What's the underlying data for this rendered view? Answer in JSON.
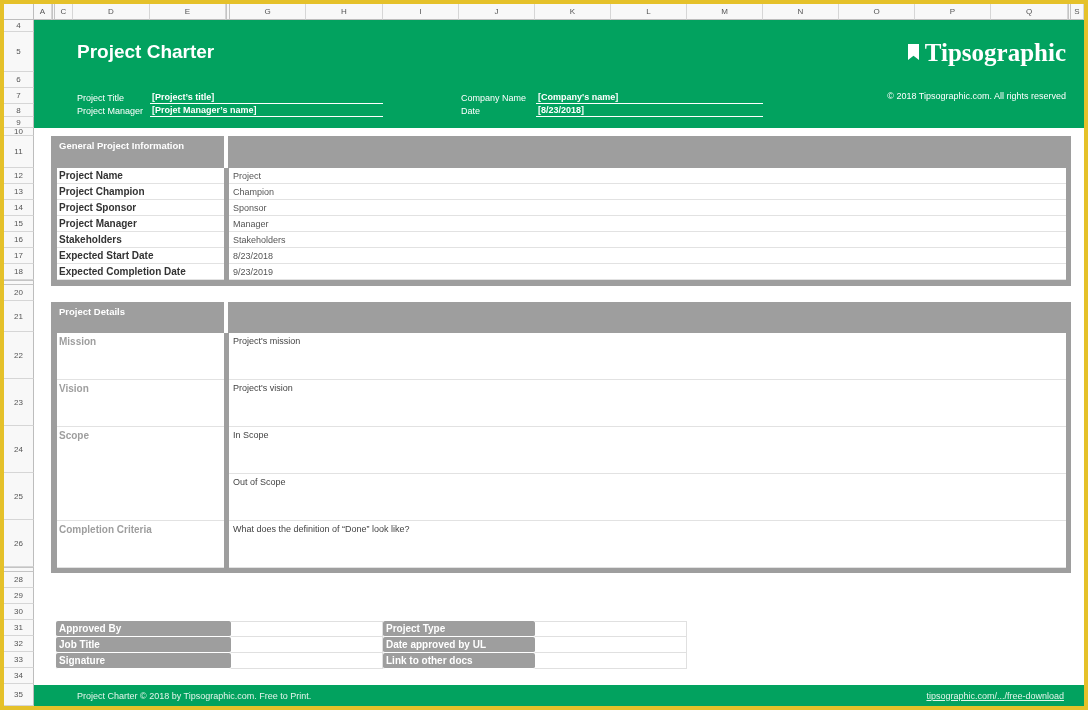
{
  "column_headers": [
    "A",
    "C",
    "D",
    "E",
    "G",
    "H",
    "I",
    "J",
    "K",
    "L",
    "M",
    "N",
    "O",
    "P",
    "Q",
    "S"
  ],
  "row_numbers": [
    "4",
    "5",
    "6",
    "7",
    "8",
    "9",
    "10",
    "11",
    "12",
    "13",
    "14",
    "15",
    "16",
    "17",
    "18",
    "20",
    "21",
    "22",
    "23",
    "24",
    "25",
    "26",
    "28",
    "29",
    "30",
    "31",
    "32",
    "33",
    "34",
    "35"
  ],
  "header": {
    "title": "Project Charter",
    "brand": "Tipsographic",
    "copyright": "© 2018 Tipsographic.com. All rights reserved",
    "fields": [
      {
        "label": "Project Title",
        "value": "[Project’s title]"
      },
      {
        "label": "Company Name",
        "value": "[Company's name]"
      },
      {
        "label": "Project Manager",
        "value": "[Projet Manager’s name]"
      },
      {
        "label": "Date",
        "value": "[8/23/2018]"
      }
    ]
  },
  "general_info": {
    "title": "General Project Information",
    "rows": [
      {
        "label": "Project Name",
        "value": "Project"
      },
      {
        "label": "Project Champion",
        "value": "Champion"
      },
      {
        "label": "Project Sponsor",
        "value": "Sponsor"
      },
      {
        "label": "Project Manager",
        "value": "Manager"
      },
      {
        "label": "Stakeholders",
        "value": "Stakeholders"
      },
      {
        "label": "Expected Start Date",
        "value": "8/23/2018"
      },
      {
        "label": "Expected Completion Date",
        "value": "9/23/2019"
      }
    ]
  },
  "project_details": {
    "title": "Project Details",
    "rows": [
      {
        "label": "Mission",
        "values": [
          "Project's mission"
        ]
      },
      {
        "label": "Vision",
        "values": [
          "Project's vision"
        ]
      },
      {
        "label": "Scope",
        "values": [
          "In Scope",
          "Out of Scope"
        ]
      },
      {
        "label": "Completion Criteria",
        "values": [
          "What does the definition of “Done” look like?"
        ]
      }
    ]
  },
  "approvals": [
    {
      "left_label": "Approved By",
      "right_label": "Project Type"
    },
    {
      "left_label": "Job Title",
      "right_label": "Date approved by UL"
    },
    {
      "left_label": "Signature",
      "right_label": "Link to other docs"
    }
  ],
  "footer": {
    "text": "Project Charter © 2018 by Tipsographic.com. Free to Print.",
    "link": "tipsographic.com/.../free-download"
  }
}
